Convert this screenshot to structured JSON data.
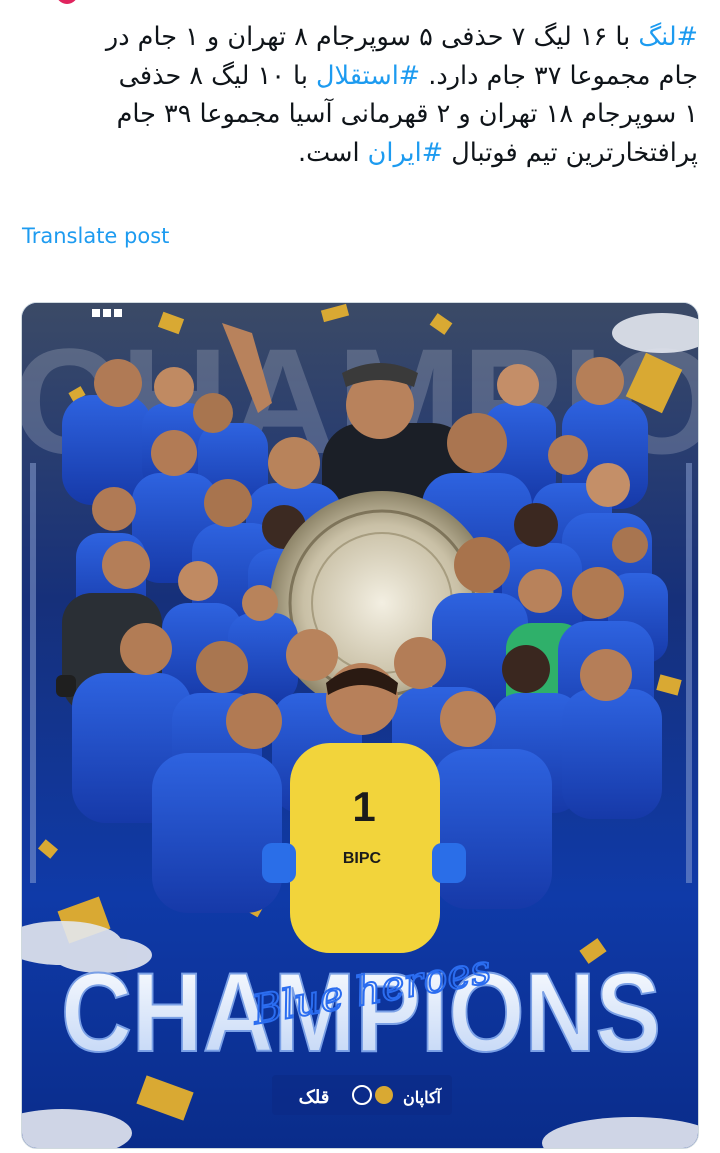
{
  "post": {
    "lines": [
      [
        {
          "t": "#لنگ",
          "tag": true
        },
        {
          "t": " با ۱۶ لیگ ۷ حذفی ۵ سوپرجام ۸ تهران و ۱ جام در",
          "tag": false
        }
      ],
      [
        {
          "t": "جام مجموعا ۳۷ جام دارد. ",
          "tag": false
        },
        {
          "t": "#استقلال",
          "tag": true
        },
        {
          "t": " با ۱۰ لیگ ۸ حذفی",
          "tag": false
        }
      ],
      [
        {
          "t": "۱ سوپرجام ۱۸ تهران و ۲ قهرمانی آسیا مجموعا ۳۹ جام",
          "tag": false
        }
      ],
      [
        {
          "t": "پرافتخارترین تیم فوتبال ",
          "tag": false
        },
        {
          "t": "#ایران",
          "tag": true
        },
        {
          "t": " است.",
          "tag": false
        }
      ]
    ],
    "translate_label": "Translate post"
  },
  "poster": {
    "title": "CHAMPIONS",
    "script_text": "Blue heroes",
    "keeper_number": "1",
    "sponsor": "BIPC",
    "sponsor_logo_1": "قلک",
    "sponsor_logo_2": "آکاپان",
    "colors": {
      "blue": "#1a4fc9",
      "dark_blue": "#0b2a86",
      "gold": "#d9a933",
      "keeper_yellow": "#f2d43b",
      "keeper_kit": "#2a2f35",
      "hashtag": "#1d9bf0"
    }
  }
}
